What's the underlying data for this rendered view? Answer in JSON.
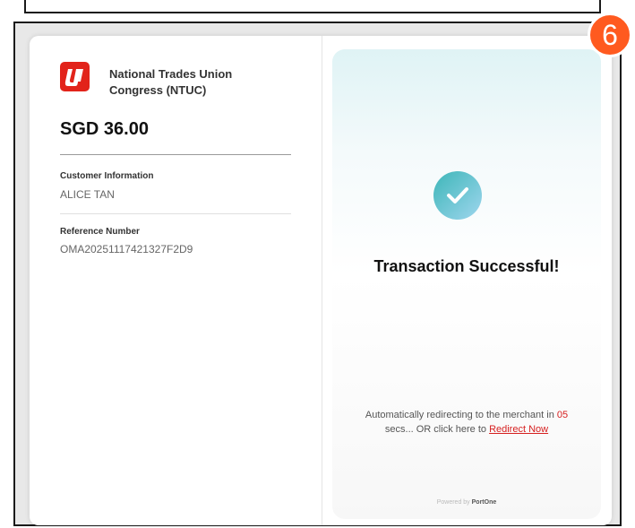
{
  "step_badge": "6",
  "merchant": {
    "name": "National Trades Union Congress (NTUC)",
    "logo_icon": "ntuc-logo-icon",
    "brand_color": "#e2231a"
  },
  "payment": {
    "amount": "SGD 36.00"
  },
  "customer": {
    "label": "Customer Information",
    "value": "ALICE TAN"
  },
  "reference": {
    "label": "Reference Number",
    "value": "OMA20251117421327F2D9"
  },
  "status": {
    "icon": "checkmark-circle-icon",
    "title": "Transaction Successful!",
    "redirect_prefix": "Automatically redirecting to the merchant in",
    "redirect_seconds": "05",
    "redirect_middle": "secs... OR click here to",
    "redirect_link": "Redirect Now"
  },
  "footer": {
    "powered_by": "Powered by",
    "brand": "PortOne"
  },
  "colors": {
    "badge": "#ff5a1f",
    "accent_red": "#d62020",
    "success_gradient_start": "#3db6b8",
    "success_gradient_end": "#9fd6ee"
  }
}
